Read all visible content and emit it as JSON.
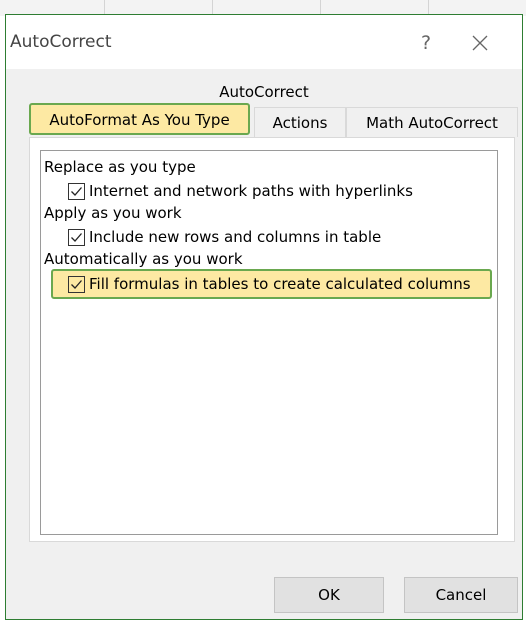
{
  "window": {
    "title": "AutoCorrect",
    "help_glyph": "?",
    "close_icon": "close-icon"
  },
  "tab_caption": "AutoCorrect",
  "tabs": [
    {
      "label": "AutoFormat As You Type",
      "selected": true
    },
    {
      "label": "Actions",
      "selected": false
    },
    {
      "label": "Math AutoCorrect",
      "selected": false
    }
  ],
  "sections": {
    "replace": {
      "heading": "Replace as you type",
      "option": {
        "label": "Internet and network paths with hyperlinks",
        "checked": true
      }
    },
    "apply": {
      "heading": "Apply as you work",
      "option": {
        "label": "Include new rows and columns in table",
        "checked": true
      }
    },
    "auto": {
      "heading": "Automatically as you work",
      "option": {
        "label": "Fill formulas in tables to create calculated columns",
        "checked": true
      }
    }
  },
  "buttons": {
    "ok": "OK",
    "cancel": "Cancel"
  },
  "colors": {
    "highlight_fill": "#fde9a3",
    "highlight_border": "#6aa84f"
  }
}
